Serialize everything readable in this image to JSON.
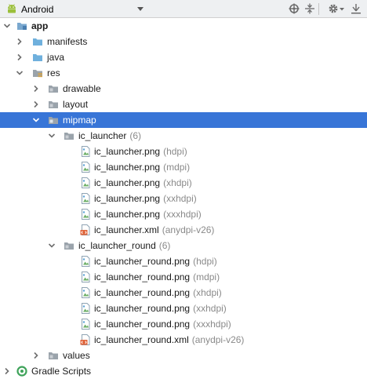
{
  "toolbar": {
    "view_mode": "Android",
    "icons": [
      "android-icon",
      "chevron-down-icon",
      "sync-target-icon",
      "collapse-all-icon",
      "gear-icon",
      "hide-panel-icon"
    ]
  },
  "colors": {
    "selection": "#3875d7",
    "folder_blue": "#6fb0dd",
    "folder_gray": "#9aa3ab",
    "suffix_gray": "#8a8a8a",
    "xml_orange": "#e0653b"
  },
  "tree": [
    {
      "label": "app",
      "suffix": "",
      "level": 0,
      "expanded": true,
      "icon": "module-folder-icon",
      "bold": true
    },
    {
      "label": "manifests",
      "suffix": "",
      "level": 1,
      "expanded": false,
      "icon": "folder-blue-icon"
    },
    {
      "label": "java",
      "suffix": "",
      "level": 1,
      "expanded": false,
      "icon": "folder-blue-icon"
    },
    {
      "label": "res",
      "suffix": "",
      "level": 1,
      "expanded": true,
      "icon": "res-folder-icon"
    },
    {
      "label": "drawable",
      "suffix": "",
      "level": 2,
      "expanded": false,
      "icon": "folder-gray-icon"
    },
    {
      "label": "layout",
      "suffix": "",
      "level": 2,
      "expanded": false,
      "icon": "folder-gray-icon"
    },
    {
      "label": "mipmap",
      "suffix": "",
      "level": 2,
      "expanded": true,
      "icon": "folder-gray-icon",
      "selected": true
    },
    {
      "label": "ic_launcher",
      "suffix": "(6)",
      "level": 3,
      "expanded": true,
      "icon": "folder-gray-icon"
    },
    {
      "label": "ic_launcher.png",
      "suffix": "(hdpi)",
      "level": 4,
      "icon": "image-file-icon"
    },
    {
      "label": "ic_launcher.png",
      "suffix": "(mdpi)",
      "level": 4,
      "icon": "image-file-icon"
    },
    {
      "label": "ic_launcher.png",
      "suffix": "(xhdpi)",
      "level": 4,
      "icon": "image-file-icon"
    },
    {
      "label": "ic_launcher.png",
      "suffix": "(xxhdpi)",
      "level": 4,
      "icon": "image-file-icon"
    },
    {
      "label": "ic_launcher.png",
      "suffix": "(xxxhdpi)",
      "level": 4,
      "icon": "image-file-icon"
    },
    {
      "label": "ic_launcher.xml",
      "suffix": "(anydpi-v26)",
      "level": 4,
      "icon": "xml-file-icon"
    },
    {
      "label": "ic_launcher_round",
      "suffix": "(6)",
      "level": 3,
      "expanded": true,
      "icon": "folder-gray-icon"
    },
    {
      "label": "ic_launcher_round.png",
      "suffix": "(hdpi)",
      "level": 4,
      "icon": "image-file-icon"
    },
    {
      "label": "ic_launcher_round.png",
      "suffix": "(mdpi)",
      "level": 4,
      "icon": "image-file-icon"
    },
    {
      "label": "ic_launcher_round.png",
      "suffix": "(xhdpi)",
      "level": 4,
      "icon": "image-file-icon"
    },
    {
      "label": "ic_launcher_round.png",
      "suffix": "(xxhdpi)",
      "level": 4,
      "icon": "image-file-icon"
    },
    {
      "label": "ic_launcher_round.png",
      "suffix": "(xxxhdpi)",
      "level": 4,
      "icon": "image-file-icon"
    },
    {
      "label": "ic_launcher_round.xml",
      "suffix": "(anydpi-v26)",
      "level": 4,
      "icon": "xml-file-icon"
    },
    {
      "label": "values",
      "suffix": "",
      "level": 2,
      "expanded": false,
      "icon": "folder-gray-icon"
    },
    {
      "label": "Gradle Scripts",
      "suffix": "",
      "level": 0,
      "expanded": false,
      "icon": "gradle-icon"
    }
  ]
}
